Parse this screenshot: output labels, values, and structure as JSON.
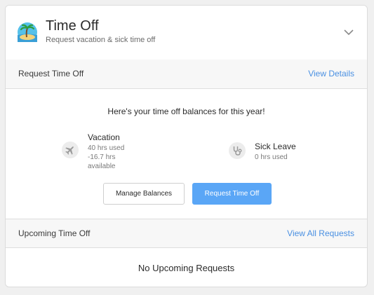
{
  "header": {
    "title": "Time Off",
    "subtitle": "Request vacation & sick time off",
    "icon": "beach-icon",
    "toggle_icon": "chevron-down-icon"
  },
  "request_section": {
    "label": "Request Time Off",
    "link": "View Details"
  },
  "balances": {
    "title": "Here's your time off balances for this year!",
    "items": [
      {
        "name": "Vacation",
        "icon": "airplane-icon",
        "lines": [
          "40 hrs used",
          "-16.7 hrs",
          "available"
        ]
      },
      {
        "name": "Sick Leave",
        "icon": "stethoscope-icon",
        "lines": [
          "0 hrs used"
        ]
      }
    ]
  },
  "actions": {
    "manage_label": "Manage Balances",
    "request_label": "Request Time Off"
  },
  "upcoming_section": {
    "label": "Upcoming Time Off",
    "link": "View All Requests",
    "empty_text": "No Upcoming Requests"
  },
  "colors": {
    "accent": "#5aa6f6",
    "link": "#4a90e2"
  }
}
